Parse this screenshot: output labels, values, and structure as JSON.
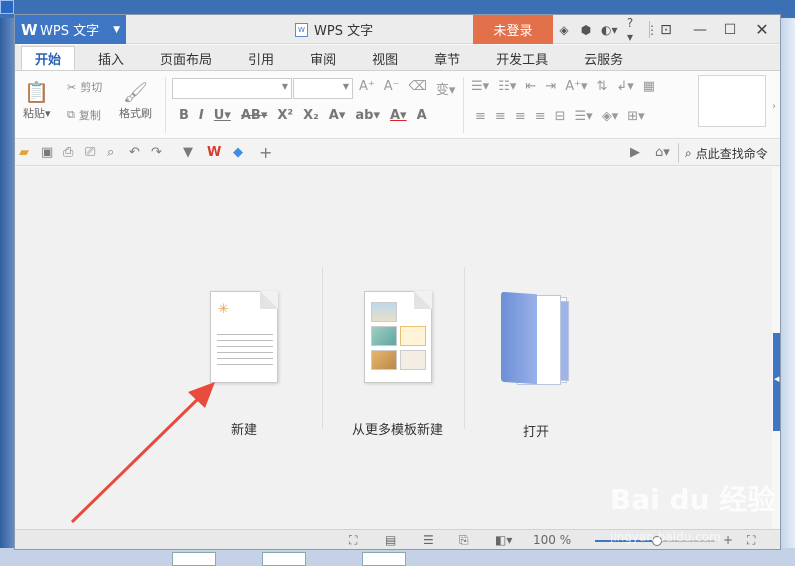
{
  "app": {
    "menu_label": "WPS 文字",
    "title": "WPS 文字",
    "login_label": "未登录",
    "title_icons": [
      "skin-icon",
      "settings-icon",
      "theme-icon",
      "help-icon",
      "more-icon"
    ],
    "help_glyph": "?"
  },
  "tabs": [
    "开始",
    "插入",
    "页面布局",
    "引用",
    "审阅",
    "视图",
    "章节",
    "开发工具",
    "云服务"
  ],
  "ribbon": {
    "paste_label": "粘贴",
    "cut_label": "剪切",
    "copy_label": "复制",
    "format_painter_label": "格式刷",
    "font_name": "",
    "font_size": ""
  },
  "quick_access": {
    "search_label": "点此查找命令"
  },
  "start_actions": [
    {
      "label": "新建"
    },
    {
      "label": "从更多模板新建"
    },
    {
      "label": "打开"
    }
  ],
  "status": {
    "zoom": "100 %"
  },
  "watermark": {
    "brand": "Bai du 经验",
    "url": "jingyan.baidu.com"
  },
  "colors": {
    "brand_blue": "#3e76c4",
    "login_orange": "#e2704a",
    "arrow_red": "#e84a3c"
  }
}
